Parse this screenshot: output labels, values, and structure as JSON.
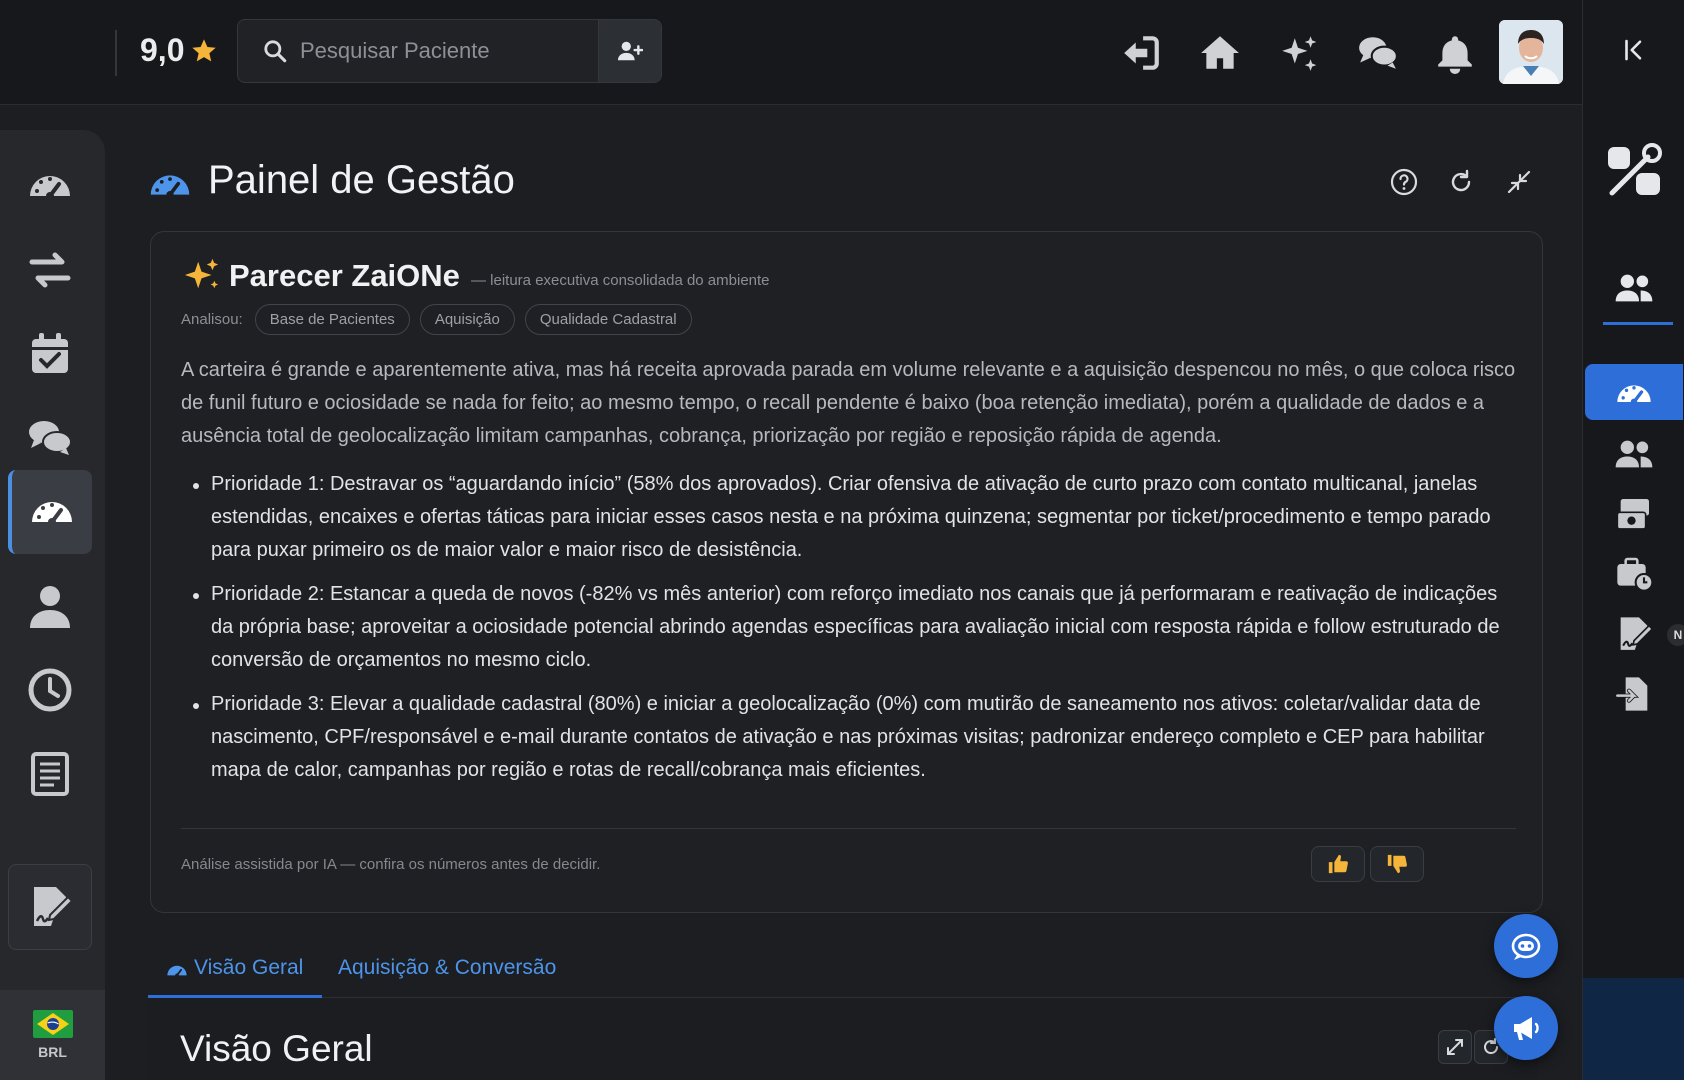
{
  "header": {
    "rating": "9,0",
    "search_placeholder": "Pesquisar Paciente"
  },
  "page": {
    "title": "Painel de Gestão"
  },
  "parecer": {
    "title": "Parecer ZaiONe",
    "subtitle": "— leitura executiva consolidada do ambiente",
    "analisou_label": "Analisou:",
    "chips": [
      "Base de Pacientes",
      "Aquisição",
      "Qualidade Cadastral"
    ],
    "summary": "A carteira é grande e aparentemente ativa, mas há receita aprovada parada em volume relevante e a aquisição despencou no mês, o que coloca risco de funil futuro e ociosidade se nada for feito; ao mesmo tempo, o recall pendente é baixo (boa retenção imediata), porém a qualidade de dados e a ausência total de geolocalização limitam campanhas, cobrança, priorização por região e reposição rápida de agenda.",
    "priorities": [
      "Prioridade 1: Destravar os “aguardando início” (58% dos aprovados). Criar ofensiva de ativação de curto prazo com contato multicanal, janelas estendidas, encaixes e ofertas táticas para iniciar esses casos nesta e na próxima quinzena; segmentar por ticket/procedimento e tempo parado para puxar primeiro os de maior valor e maior risco de desistência.",
      "Prioridade 2: Estancar a queda de novos (-82% vs mês anterior) com reforço imediato nos canais que já performaram e reativação de indicações da própria base; aproveitar a ociosidade potencial abrindo agendas específicas para avaliação inicial com resposta rápida e follow estruturado de conversão de orçamentos no mesmo ciclo.",
      "Prioridade 3: Elevar a qualidade cadastral (80%) e iniciar a geolocalização (0%) com mutirão de saneamento nos ativos: coletar/validar data de nascimento, CPF/responsável e e-mail durante contatos de ativação e nas próximas visitas; padronizar endereço completo e CEP para habilitar mapa de calor, campanhas por região e rotas de recall/cobrança mais eficientes."
    ],
    "disclaimer": "Análise assistida por IA — confira os números antes de decidir."
  },
  "tabs": [
    {
      "label": "Visão Geral",
      "active": true
    },
    {
      "label": "Aquisição & Conversão",
      "active": false
    }
  ],
  "section": {
    "title": "Visão Geral"
  },
  "footer": {
    "currency": "BRL"
  },
  "rightbar": {
    "badge": "N"
  },
  "colors": {
    "accent": "#2d6ed8",
    "link": "#4d94ea",
    "star": "#f5b53a",
    "background": "#1c1e22"
  }
}
